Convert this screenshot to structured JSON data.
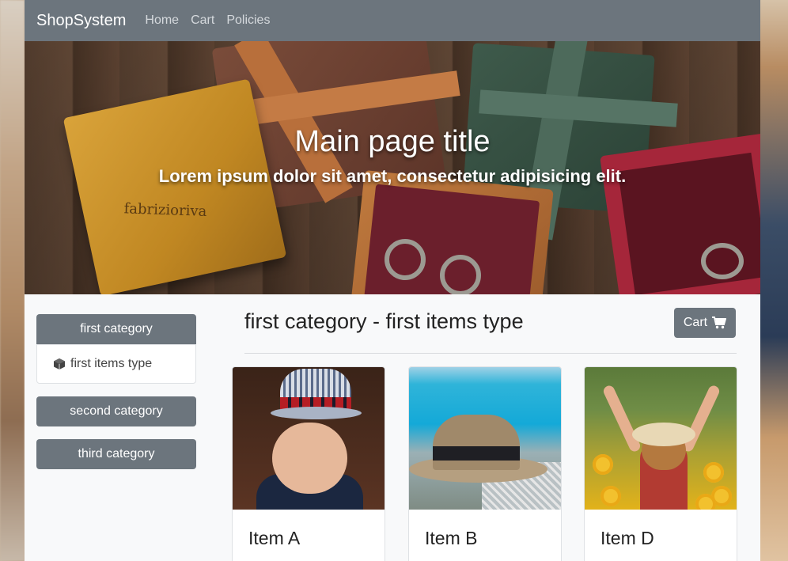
{
  "navbar": {
    "brand": "ShopSystem",
    "links": [
      "Home",
      "Cart",
      "Policies"
    ]
  },
  "hero": {
    "title": "Main page title",
    "subtitle": "Lorem ipsum dolor sit amet, consectetur adipisicing elit.",
    "box_brand": "fabrizioriva"
  },
  "sidebar": {
    "categories": [
      {
        "label": "first category",
        "sub_items": [
          "first items type"
        ]
      },
      {
        "label": "second category"
      },
      {
        "label": "third category"
      }
    ]
  },
  "content": {
    "title": "first category - first items type",
    "cart_button": "Cart",
    "items": [
      {
        "name": "Item A"
      },
      {
        "name": "Item B"
      },
      {
        "name": "Item D"
      }
    ]
  },
  "colors": {
    "navbar": "#6c757d",
    "button": "#6c757d",
    "page_background": "#f8f9fa"
  },
  "icons": {
    "cart": "shopping-cart-icon",
    "items_type": "cube-icon"
  }
}
